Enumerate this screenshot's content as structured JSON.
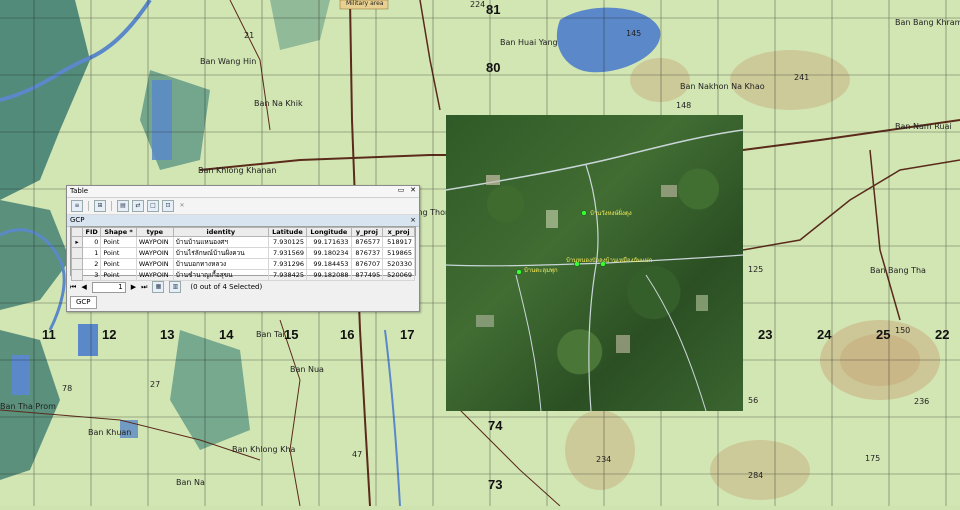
{
  "map": {
    "area_label": "Military area",
    "grid_numbers": [
      "81",
      "80",
      "74",
      "73",
      "11",
      "12",
      "13",
      "14",
      "15",
      "16",
      "17",
      "22",
      "23",
      "24",
      "25"
    ],
    "place_labels": [
      "Ban Wang Hin",
      "Ban Na Khik",
      "Ban Khlong Khanan",
      "Ban Huai Yang",
      "Ban Nakhon Na Khao",
      "Ban Bang Khram",
      "Ban Tai",
      "Ban Nua",
      "Ban Khuan",
      "Ban Khlong Kha",
      "Ban Na",
      "Ban Khlong Thom",
      "Ban Bang Tha",
      "Ban Tha Prom",
      "Ban Nam Ruai"
    ],
    "elevations": [
      "224",
      "21",
      "145",
      "148",
      "241",
      "125",
      "150",
      "236",
      "175",
      "234",
      "284",
      "56",
      "47",
      "78",
      "27"
    ],
    "ortho_labels": [
      "บ้านวังหงษ์ฝั่งดุง",
      "บ้านตะลุมพุก",
      "บ้านหนองบัวลงบ้านเหมืองกับแม่ก"
    ]
  },
  "window": {
    "title": "Table",
    "minimize": "▭",
    "close": "✕",
    "tab_name": "GCP",
    "tab_close": "×",
    "bottom_tab": "GCP",
    "toolbar_icons": [
      "table-options-icon",
      "related-tables-icon",
      "select-by-attributes-icon",
      "switch-selection-icon",
      "clear-selection-icon",
      "zoom-to-selected-icon",
      "delete-selected-icon"
    ]
  },
  "table": {
    "columns": [
      "FID",
      "Shape *",
      "type",
      "identity",
      "Latitude",
      "Longitude",
      "y_proj",
      "x_proj"
    ],
    "rows": [
      [
        "0",
        "Point",
        "WAYPOIN",
        "บ้านบ้านแหนองศฯ",
        "7.930125",
        "99.171633",
        "876577",
        "518917"
      ],
      [
        "1",
        "Point",
        "WAYPOIN",
        "บ้านไร่ลักษณ์บ้านฝั่งควน",
        "7.931569",
        "99.180234",
        "876737",
        "519865"
      ],
      [
        "2",
        "Point",
        "WAYPOIN",
        "บ้านบอกทางหลวง",
        "7.931296",
        "99.184453",
        "876707",
        "520330"
      ],
      [
        "3",
        "Point",
        "WAYPOIN",
        "บ้านชำนาญเกื้อสุขน",
        "7.938425",
        "99.182088",
        "877495",
        "520069"
      ]
    ]
  },
  "navigator": {
    "first": "⏮",
    "prev": "◀",
    "page": "1",
    "next": "▶",
    "last": "⏭",
    "status": "(0 out of 4 Selected)"
  },
  "colors": {
    "map_green": "#cfe3b0",
    "forest": "#2e6b6b",
    "water": "#5a88c8",
    "road": "#5a2a1a",
    "grid": "#1a1a1a"
  }
}
